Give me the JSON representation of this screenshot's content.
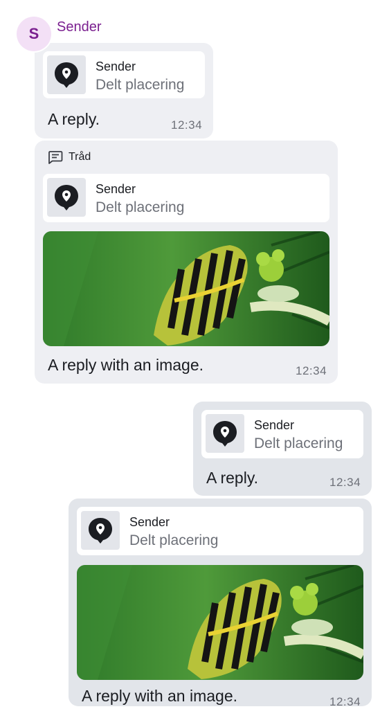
{
  "sender_header": {
    "avatar_initial": "S",
    "name": "Sender"
  },
  "reply_preview": {
    "title": "Sender",
    "subtitle": "Delt placering"
  },
  "thread": {
    "label": "Tråd"
  },
  "messages": [
    {
      "text": "A reply.",
      "time": "12:34"
    },
    {
      "text": "A reply with an image.",
      "time": "12:34"
    },
    {
      "text": "A reply.",
      "time": "12:34"
    },
    {
      "text": "A reply with an image.",
      "time": "12:34"
    }
  ],
  "colors": {
    "sender": "#7a1f8f",
    "bubble_incoming": "#eeeff3",
    "bubble_outgoing": "#e2e5ea"
  }
}
